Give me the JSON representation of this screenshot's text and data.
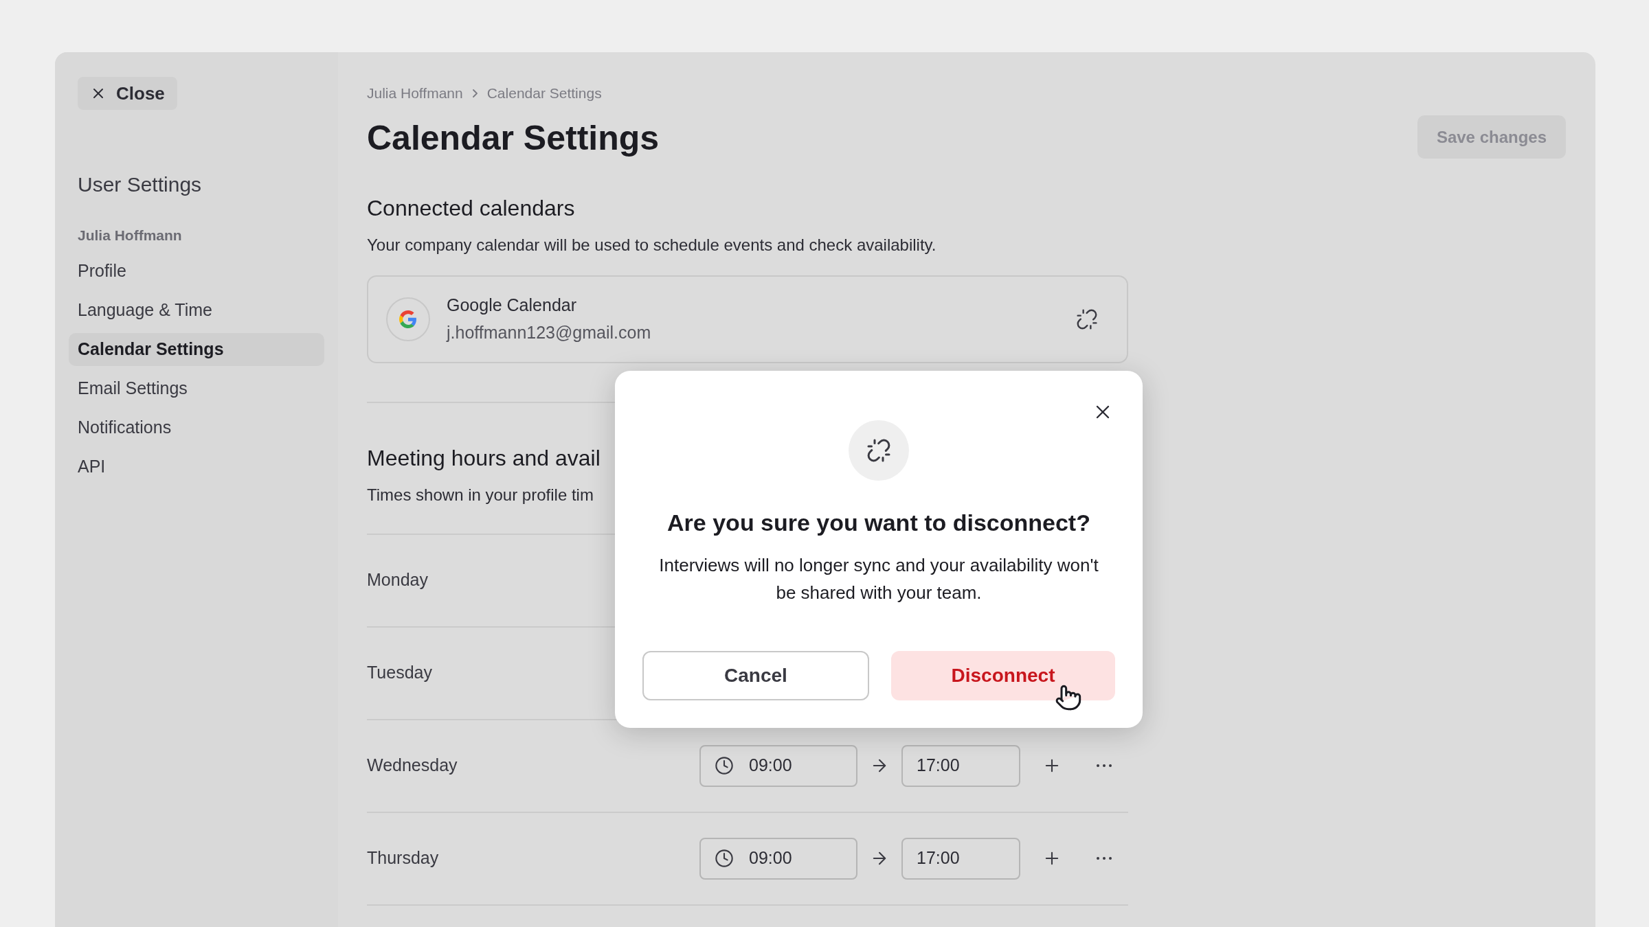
{
  "sidebar": {
    "close_button": "Close",
    "heading": "User Settings",
    "account_name": "Julia Hoffmann",
    "items": [
      {
        "label": "Profile",
        "selected": false
      },
      {
        "label": "Language & Time",
        "selected": false
      },
      {
        "label": "Calendar Settings",
        "selected": true
      },
      {
        "label": "Email Settings",
        "selected": false
      },
      {
        "label": "Notifications",
        "selected": false
      },
      {
        "label": "API",
        "selected": false
      }
    ]
  },
  "header": {
    "breadcrumb": [
      "Julia Hoffmann",
      "Calendar Settings"
    ],
    "title": "Calendar Settings",
    "save_button": {
      "label": "Save changes",
      "disabled": true
    }
  },
  "connected_calendars": {
    "heading": "Connected calendars",
    "description": "Your company calendar will be used to schedule events and check availability.",
    "calendar": {
      "name": "Google Calendar",
      "email": "j.hoffmann123@gmail.com"
    }
  },
  "meeting_hours": {
    "heading": "Meeting hours and avail",
    "description": "Times shown in your profile tim",
    "days": [
      {
        "day": "Monday"
      },
      {
        "day": "Tuesday"
      },
      {
        "day": "Wednesday",
        "start": "09:00",
        "end": "17:00"
      },
      {
        "day": "Thursday",
        "start": "09:00",
        "end": "17:00"
      }
    ]
  },
  "dialog": {
    "title": "Are you sure you want to disconnect?",
    "message": "Interviews will no longer sync and your availability won't be shared with your team.",
    "buttons": [
      {
        "label": "Cancel",
        "kind": "secondary"
      },
      {
        "label": "Disconnect",
        "kind": "danger"
      }
    ]
  }
}
